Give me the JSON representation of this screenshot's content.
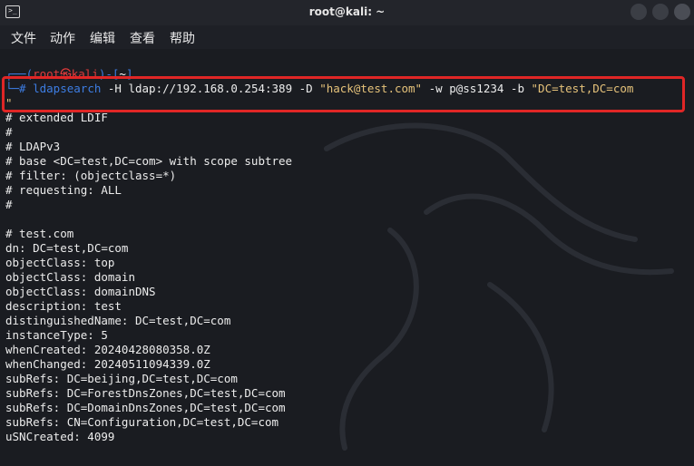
{
  "window": {
    "title": "root@kali: ~"
  },
  "menu": [
    "文件",
    "动作",
    "编辑",
    "查看",
    "帮助"
  ],
  "prompt": {
    "top": "┌──(root㉿kali)-[~]",
    "user": "root",
    "at": "㉿",
    "host": "kali",
    "dir": "~"
  },
  "command": {
    "prefix": "└─# ",
    "name": "ldapsearch",
    "args1": " -H ldap://192.168.0.254:389 -D ",
    "bind_dn": "\"hack@test.com\"",
    "args2": " -w p@ss1234 -b ",
    "base": "\"DC=test,DC=com",
    "wrap": "\""
  },
  "output": [
    "# extended LDIF",
    "#",
    "# LDAPv3",
    "# base <DC=test,DC=com> with scope subtree",
    "# filter: (objectclass=*)",
    "# requesting: ALL",
    "#",
    "",
    "# test.com",
    "dn: DC=test,DC=com",
    "objectClass: top",
    "objectClass: domain",
    "objectClass: domainDNS",
    "description: test",
    "distinguishedName: DC=test,DC=com",
    "instanceType: 5",
    "whenCreated: 20240428080358.0Z",
    "whenChanged: 20240511094339.0Z",
    "subRefs: DC=beijing,DC=test,DC=com",
    "subRefs: DC=ForestDnsZones,DC=test,DC=com",
    "subRefs: DC=DomainDnsZones,DC=test,DC=com",
    "subRefs: CN=Configuration,DC=test,DC=com",
    "uSNCreated: 4099"
  ],
  "colors": {
    "highlight": "#e02626",
    "prompt": "#3d7de3",
    "host": "#e23b3b",
    "string": "#e5c27a"
  },
  "icons": [
    "terminal-icon",
    "minimize-icon",
    "maximize-icon",
    "close-icon",
    "kali-dragon-icon"
  ]
}
